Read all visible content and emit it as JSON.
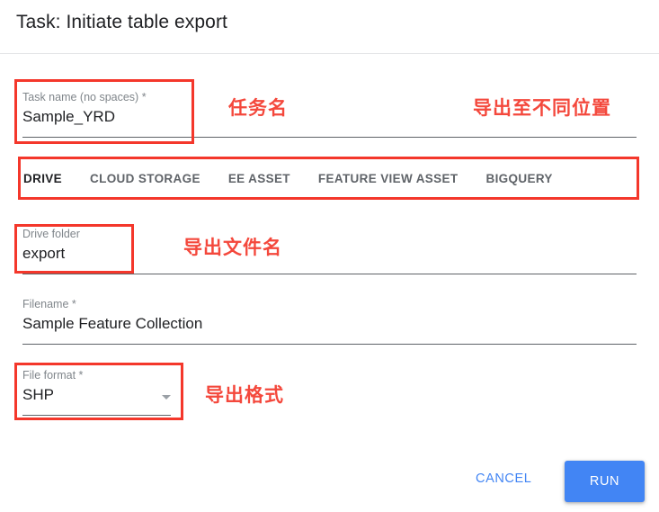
{
  "dialog": {
    "title": "Task: Initiate table export"
  },
  "fields": {
    "task_name": {
      "label": "Task name (no spaces) *",
      "value": "Sample_YRD"
    },
    "drive_folder": {
      "label": "Drive folder",
      "value": "export"
    },
    "filename": {
      "label": "Filename *",
      "value": "Sample Feature Collection"
    },
    "file_format": {
      "label": "File format *",
      "value": "SHP",
      "arrow_icon": "chevron-down-icon"
    }
  },
  "tabs": [
    {
      "label": "DRIVE",
      "active": true
    },
    {
      "label": "CLOUD STORAGE",
      "active": false
    },
    {
      "label": "EE ASSET",
      "active": false
    },
    {
      "label": "FEATURE VIEW ASSET",
      "active": false
    },
    {
      "label": "BIGQUERY",
      "active": false
    }
  ],
  "footer": {
    "cancel_label": "CANCEL",
    "run_label": "RUN"
  },
  "annotations": {
    "task_name_note": "任务名",
    "export_location_note": "导出至不同位置",
    "export_filename_note": "导出文件名",
    "export_format_note": "导出格式"
  },
  "colors": {
    "accent_blue": "#4285f4",
    "annotation_red": "#f4483c",
    "label_gray": "#80868b",
    "text_dark": "#202124"
  }
}
